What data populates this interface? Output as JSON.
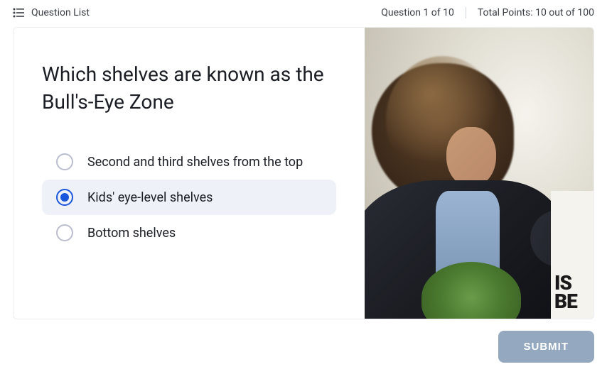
{
  "topBar": {
    "questionListLabel": "Question List",
    "progressLabel": "Question 1 of 10",
    "pointsLabel": "Total Points: 10 out of 100"
  },
  "question": {
    "title": "Which shelves are known as the Bull's-Eye Zone",
    "options": [
      {
        "label": "Second and third shelves from the top",
        "selected": false
      },
      {
        "label": "Kids' eye-level shelves",
        "selected": true
      },
      {
        "label": "Bottom shelves",
        "selected": false
      }
    ]
  },
  "submit": {
    "label": "SUBMIT"
  },
  "image": {
    "description": "Woman with curly hair in leather jacket shopping for groceries",
    "signText": "IS\nBE"
  }
}
